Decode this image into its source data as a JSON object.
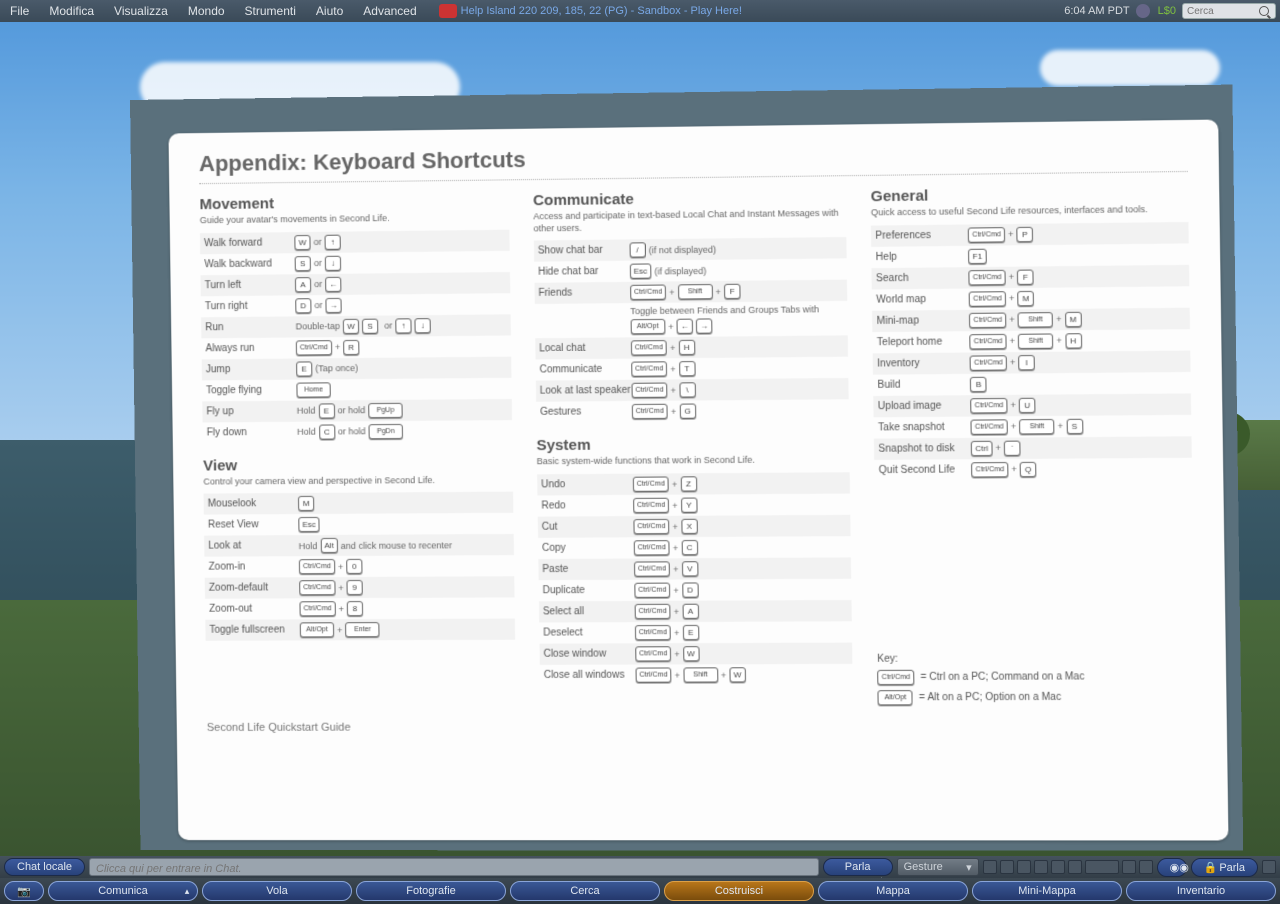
{
  "menu": {
    "items": [
      "File",
      "Modifica",
      "Visualizza",
      "Mondo",
      "Strumenti",
      "Aiuto",
      "Advanced"
    ],
    "location": "Help Island 220 209, 185, 22 (PG) - Sandbox - Play Here!",
    "clock": "6:04 AM PDT",
    "balance": "L$0"
  },
  "search": {
    "placeholder": "Cerca"
  },
  "doc": {
    "title": "Appendix: Keyboard Shortcuts",
    "footer": "Second Life Quickstart Guide",
    "movement": {
      "title": "Movement",
      "desc": "Guide your avatar's movements in Second Life.",
      "rows": [
        {
          "l": "Walk forward",
          "k": [
            [
              "W"
            ],
            "or",
            [
              "↑"
            ]
          ]
        },
        {
          "l": "Walk backward",
          "k": [
            [
              "S"
            ],
            "or",
            [
              "↓"
            ]
          ]
        },
        {
          "l": "Turn left",
          "k": [
            [
              "A"
            ],
            "or",
            [
              "←"
            ]
          ]
        },
        {
          "l": "Turn right",
          "k": [
            [
              "D"
            ],
            "or",
            [
              "→"
            ]
          ]
        },
        {
          "l": "Run",
          "k": [
            "Double-tap",
            [
              "W"
            ],
            [
              "S"
            ],
            "",
            "or",
            [
              "↑"
            ],
            [
              "↓"
            ]
          ]
        },
        {
          "l": "Always run",
          "k": [
            [
              "Ctrl/Cmd",
              "w"
            ],
            "+",
            [
              "R"
            ]
          ]
        },
        {
          "l": "Jump",
          "k": [
            [
              "E"
            ],
            "(Tap once)"
          ]
        },
        {
          "l": "Toggle flying",
          "k": [
            [
              "Home",
              "w"
            ]
          ]
        },
        {
          "l": "Fly up",
          "k": [
            "Hold",
            [
              "E"
            ],
            "or hold",
            [
              "PgUp",
              "w"
            ]
          ]
        },
        {
          "l": "Fly down",
          "k": [
            "Hold",
            [
              "C"
            ],
            "or hold",
            [
              "PgDn",
              "w"
            ]
          ]
        }
      ]
    },
    "view": {
      "title": "View",
      "desc": "Control your camera view and perspective in Second Life.",
      "rows": [
        {
          "l": "Mouselook",
          "k": [
            [
              "M"
            ]
          ]
        },
        {
          "l": "Reset View",
          "k": [
            [
              "Esc"
            ]
          ]
        },
        {
          "l": "Look at",
          "k": [
            "Hold",
            [
              "Alt"
            ],
            "and click mouse to recenter"
          ]
        },
        {
          "l": "Zoom-in",
          "k": [
            [
              "Ctrl/Cmd",
              "w"
            ],
            "+",
            [
              "0"
            ]
          ]
        },
        {
          "l": "Zoom-default",
          "k": [
            [
              "Ctrl/Cmd",
              "w"
            ],
            "+",
            [
              "9"
            ]
          ]
        },
        {
          "l": "Zoom-out",
          "k": [
            [
              "Ctrl/Cmd",
              "w"
            ],
            "+",
            [
              "8"
            ]
          ]
        },
        {
          "l": "Toggle fullscreen",
          "k": [
            [
              "Alt/Opt",
              "w"
            ],
            "+",
            [
              "Enter",
              "w"
            ]
          ]
        }
      ]
    },
    "comm": {
      "title": "Communicate",
      "desc": "Access and participate in text-based Local Chat and Instant Messages with other users.",
      "rows": [
        {
          "l": "Show chat bar",
          "k": [
            [
              "/"
            ],
            "(if not displayed)"
          ]
        },
        {
          "l": "Hide chat bar",
          "k": [
            [
              "Esc"
            ],
            "(if displayed)"
          ]
        },
        {
          "l": "Friends",
          "k": [
            [
              "Ctrl/Cmd",
              "w"
            ],
            "+",
            [
              "Shift",
              "w"
            ],
            "+",
            [
              "F"
            ]
          ]
        },
        {
          "l": "",
          "k": [
            "Toggle between Friends and Groups Tabs with",
            [
              "Alt/Opt",
              "w"
            ],
            "+",
            [
              "←"
            ],
            [
              "→"
            ]
          ]
        },
        {
          "l": "Local chat",
          "k": [
            [
              "Ctrl/Cmd",
              "w"
            ],
            "+",
            [
              "H"
            ]
          ]
        },
        {
          "l": "Communicate",
          "k": [
            [
              "Ctrl/Cmd",
              "w"
            ],
            "+",
            [
              "T"
            ]
          ]
        },
        {
          "l": "Look at last speaker",
          "k": [
            [
              "Ctrl/Cmd",
              "w"
            ],
            "+",
            [
              "\\"
            ]
          ]
        },
        {
          "l": "Gestures",
          "k": [
            [
              "Ctrl/Cmd",
              "w"
            ],
            "+",
            [
              "G"
            ]
          ]
        }
      ]
    },
    "system": {
      "title": "System",
      "desc": "Basic system-wide functions that work in Second Life.",
      "rows": [
        {
          "l": "Undo",
          "k": [
            [
              "Ctrl/Cmd",
              "w"
            ],
            "+",
            [
              "Z"
            ]
          ]
        },
        {
          "l": "Redo",
          "k": [
            [
              "Ctrl/Cmd",
              "w"
            ],
            "+",
            [
              "Y"
            ]
          ]
        },
        {
          "l": "Cut",
          "k": [
            [
              "Ctrl/Cmd",
              "w"
            ],
            "+",
            [
              "X"
            ]
          ]
        },
        {
          "l": "Copy",
          "k": [
            [
              "Ctrl/Cmd",
              "w"
            ],
            "+",
            [
              "C"
            ]
          ]
        },
        {
          "l": "Paste",
          "k": [
            [
              "Ctrl/Cmd",
              "w"
            ],
            "+",
            [
              "V"
            ]
          ]
        },
        {
          "l": "Duplicate",
          "k": [
            [
              "Ctrl/Cmd",
              "w"
            ],
            "+",
            [
              "D"
            ]
          ]
        },
        {
          "l": "Select all",
          "k": [
            [
              "Ctrl/Cmd",
              "w"
            ],
            "+",
            [
              "A"
            ]
          ]
        },
        {
          "l": "Deselect",
          "k": [
            [
              "Ctrl/Cmd",
              "w"
            ],
            "+",
            [
              "E"
            ]
          ]
        },
        {
          "l": "Close window",
          "k": [
            [
              "Ctrl/Cmd",
              "w"
            ],
            "+",
            [
              "W"
            ]
          ]
        },
        {
          "l": "Close all windows",
          "k": [
            [
              "Ctrl/Cmd",
              "w"
            ],
            "+",
            [
              "Shift",
              "w"
            ],
            "+",
            [
              "W"
            ]
          ]
        }
      ]
    },
    "general": {
      "title": "General",
      "desc": "Quick access to useful Second Life resources, interfaces and tools.",
      "rows": [
        {
          "l": "Preferences",
          "k": [
            [
              "Ctrl/Cmd",
              "w"
            ],
            "+",
            [
              "P"
            ]
          ]
        },
        {
          "l": "Help",
          "k": [
            [
              "F1"
            ]
          ]
        },
        {
          "l": "Search",
          "k": [
            [
              "Ctrl/Cmd",
              "w"
            ],
            "+",
            [
              "F"
            ]
          ]
        },
        {
          "l": "World map",
          "k": [
            [
              "Ctrl/Cmd",
              "w"
            ],
            "+",
            [
              "M"
            ]
          ]
        },
        {
          "l": "Mini-map",
          "k": [
            [
              "Ctrl/Cmd",
              "w"
            ],
            "+",
            [
              "Shift",
              "w"
            ],
            "+",
            [
              "M"
            ]
          ]
        },
        {
          "l": "Teleport home",
          "k": [
            [
              "Ctrl/Cmd",
              "w"
            ],
            "+",
            [
              "Shift",
              "w"
            ],
            "+",
            [
              "H"
            ]
          ]
        },
        {
          "l": "Inventory",
          "k": [
            [
              "Ctrl/Cmd",
              "w"
            ],
            "+",
            [
              "I"
            ]
          ]
        },
        {
          "l": "Build",
          "k": [
            [
              "B"
            ]
          ]
        },
        {
          "l": "Upload image",
          "k": [
            [
              "Ctrl/Cmd",
              "w"
            ],
            "+",
            [
              "U"
            ]
          ]
        },
        {
          "l": "Take snapshot",
          "k": [
            [
              "Ctrl/Cmd",
              "w"
            ],
            "+",
            [
              "Shift",
              "w"
            ],
            "+",
            [
              "S"
            ]
          ]
        },
        {
          "l": "Snapshot to disk",
          "k": [
            [
              "Ctrl"
            ],
            "+",
            [
              "`"
            ]
          ]
        },
        {
          "l": "Quit Second Life",
          "k": [
            [
              "Ctrl/Cmd",
              "w"
            ],
            "+",
            [
              "Q"
            ]
          ]
        }
      ]
    },
    "key": {
      "title": "Key:",
      "line1": "= Ctrl on a PC; Command on a Mac",
      "line2": "= Alt on a PC; Option on a Mac",
      "k1": "Ctrl/Cmd",
      "k2": "Alt/Opt"
    }
  },
  "chatbar": {
    "chatlocale": "Chat locale",
    "placeholder": "Clicca qui per entrare in Chat.",
    "parla": "Parla",
    "gesture": "Gesture",
    "parla2": "Parla"
  },
  "toolbar": {
    "items": [
      "Comunica",
      "Vola",
      "Fotografie",
      "Cerca",
      "Costruisci",
      "Mappa",
      "Mini-Mappa",
      "Inventario"
    ]
  }
}
